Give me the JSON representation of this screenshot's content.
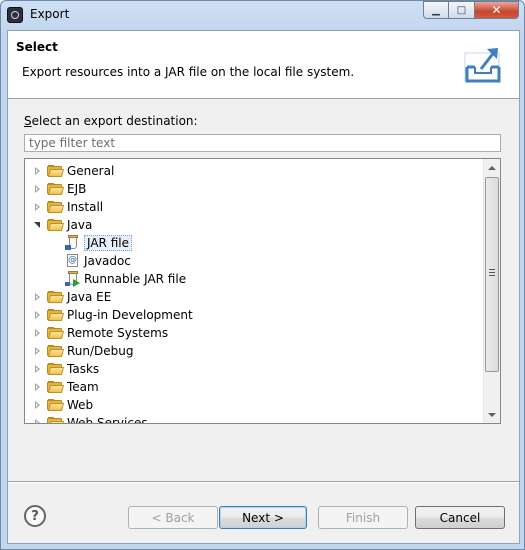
{
  "window": {
    "title": "Export",
    "minimize_label": "▁",
    "maximize_label": "□",
    "close_label": "✕"
  },
  "banner": {
    "title": "Select",
    "description": "Export resources into a JAR file on the local file system.",
    "icon": "export-icon"
  },
  "destination": {
    "label_mnemonic": "S",
    "label_rest": "elect an export destination:",
    "filter_placeholder": "type filter text",
    "filter_value": ""
  },
  "tree": {
    "items": [
      {
        "label": "General",
        "type": "folder",
        "expanded": false,
        "level": 0
      },
      {
        "label": "EJB",
        "type": "folder",
        "expanded": false,
        "level": 0
      },
      {
        "label": "Install",
        "type": "folder",
        "expanded": false,
        "level": 0
      },
      {
        "label": "Java",
        "type": "folder",
        "expanded": true,
        "level": 0
      },
      {
        "label": "JAR file",
        "type": "jar",
        "selected": true,
        "level": 1
      },
      {
        "label": "Javadoc",
        "type": "javadoc",
        "level": 1
      },
      {
        "label": "Runnable JAR file",
        "type": "runnable-jar",
        "level": 1
      },
      {
        "label": "Java EE",
        "type": "folder",
        "expanded": false,
        "level": 0
      },
      {
        "label": "Plug-in Development",
        "type": "folder",
        "expanded": false,
        "level": 0
      },
      {
        "label": "Remote Systems",
        "type": "folder",
        "expanded": false,
        "level": 0
      },
      {
        "label": "Run/Debug",
        "type": "folder",
        "expanded": false,
        "level": 0
      },
      {
        "label": "Tasks",
        "type": "folder",
        "expanded": false,
        "level": 0
      },
      {
        "label": "Team",
        "type": "folder",
        "expanded": false,
        "level": 0
      },
      {
        "label": "Web",
        "type": "folder",
        "expanded": false,
        "level": 0
      },
      {
        "label": "Web Services",
        "type": "folder",
        "expanded": false,
        "level": 0
      }
    ]
  },
  "buttons": {
    "help_label": "?",
    "back_label": "< Back",
    "next_label": "Next >",
    "finish_label": "Finish",
    "cancel_label": "Cancel"
  }
}
